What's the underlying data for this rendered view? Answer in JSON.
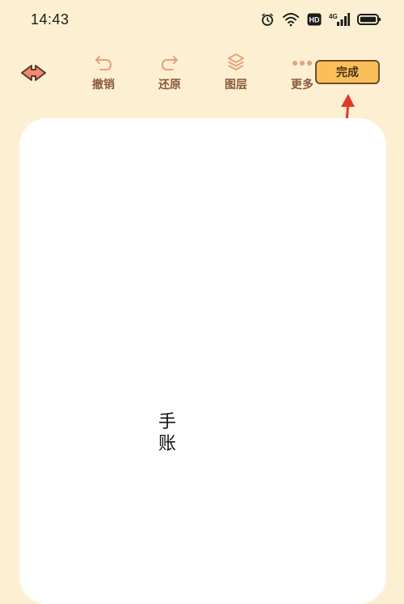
{
  "status_bar": {
    "time": "14:43",
    "icons": [
      "alarm-icon",
      "wifi-icon",
      "hd-icon",
      "4g-signal-icon",
      "battery-icon"
    ],
    "hd_label": "HD",
    "network_label": "4G"
  },
  "toolbar": {
    "back_icon": "back-arrow-icon",
    "undo_label": "撤销",
    "redo_label": "还原",
    "layers_label": "图层",
    "more_label": "更多",
    "done_label": "完成"
  },
  "canvas": {
    "text_line1": "手",
    "text_line2": "账"
  },
  "colors": {
    "background": "#fdf0d2",
    "accent": "#f9bf58",
    "tool_brown": "#8a5a3c",
    "annotation_red": "#e03a2a"
  }
}
